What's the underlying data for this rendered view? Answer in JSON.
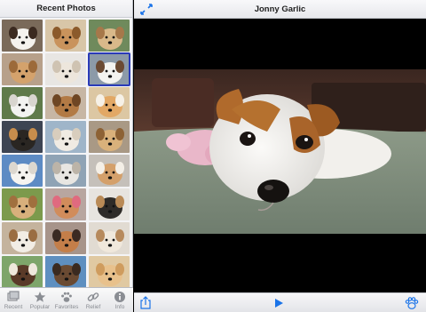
{
  "sidebar": {
    "title": "Recent Photos",
    "thumbnails": [
      {
        "bg": "#7a6a5a",
        "dog": "#f4f2ee",
        "spot": "#3b2a20"
      },
      {
        "bg": "#d8c6a8",
        "dog": "#c9935c",
        "spot": "#8b5a2b"
      },
      {
        "bg": "#6f8a5c",
        "dog": "#d9b98a",
        "spot": "#a6784a"
      },
      {
        "bg": "#b7a08a",
        "dog": "#d4a26c",
        "spot": "#9c6a3a"
      },
      {
        "bg": "#e8e6e3",
        "dog": "#ede6dc",
        "spot": "#cfc3b2"
      },
      {
        "bg": "#8c9aa8",
        "dog": "#f4f3f0",
        "spot": "#6b4a33"
      },
      {
        "bg": "#5f7a4a",
        "dog": "#f3f3f1",
        "spot": "#d8d5cf"
      },
      {
        "bg": "#c7b6a4",
        "dog": "#b27a45",
        "spot": "#6e4624"
      },
      {
        "bg": "#dcc7a3",
        "dog": "#e2a865",
        "spot": "#f6f1e7"
      },
      {
        "bg": "#3d4452",
        "dog": "#2a2622",
        "spot": "#c78d4c"
      },
      {
        "bg": "#9fb5c9",
        "dog": "#f0ebe3",
        "spot": "#d8cdbd"
      },
      {
        "bg": "#a99985",
        "dog": "#d9b17b",
        "spot": "#8d6235"
      },
      {
        "bg": "#5d8bc4",
        "dog": "#f6f4f0",
        "spot": "#dcd7cf"
      },
      {
        "bg": "#8fa3b5",
        "dog": "#e8e6e2",
        "spot": "#bcb4a8"
      },
      {
        "bg": "#c5c0ba",
        "dog": "#d4a06b",
        "spot": "#f4efe7"
      },
      {
        "bg": "#7c9a4c",
        "dog": "#d8b07c",
        "spot": "#a0703e"
      },
      {
        "bg": "#b8a6a0",
        "dog": "#d18c5b",
        "spot": "#e06a7f"
      },
      {
        "bg": "#e7e4df",
        "dog": "#2e2b28",
        "spot": "#b98a56"
      },
      {
        "bg": "#c4b39d",
        "dog": "#f2ede5",
        "spot": "#9a6d42"
      },
      {
        "bg": "#a7948a",
        "dog": "#c47e49",
        "spot": "#3a2a22"
      },
      {
        "bg": "#e1dbd2",
        "dog": "#f0e8dc",
        "spot": "#b78a5d"
      },
      {
        "bg": "#7ea56a",
        "dog": "#5a3a28",
        "spot": "#efe8dc"
      },
      {
        "bg": "#5e8fc0",
        "dog": "#6a4a32",
        "spot": "#3a2a20"
      },
      {
        "bg": "#e0c9a2",
        "dog": "#e8c18c",
        "spot": "#cf9c5e"
      }
    ],
    "selected_index": 5
  },
  "tabs": [
    {
      "label": "Recent",
      "icon": "recent-photos-icon"
    },
    {
      "label": "Popular",
      "icon": "star-icon"
    },
    {
      "label": "Favorites",
      "icon": "paw-icon"
    },
    {
      "label": "Relief",
      "icon": "link-icon"
    },
    {
      "label": "Info",
      "icon": "info-icon"
    }
  ],
  "main": {
    "title": "Jonny Garlic",
    "colors": {
      "accent": "#1a73e8",
      "bar_text": "#222222"
    }
  }
}
